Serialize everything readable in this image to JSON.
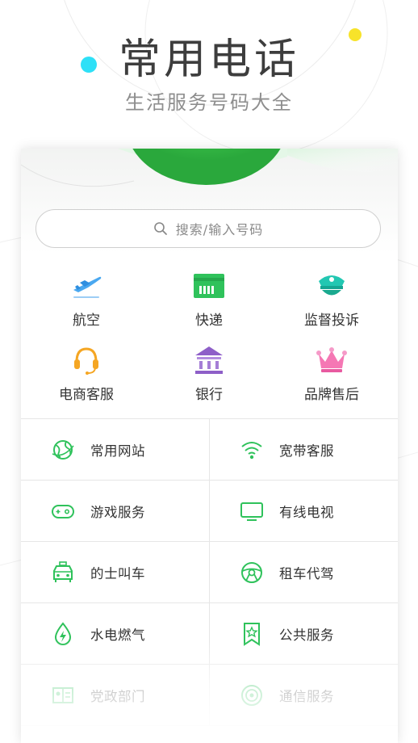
{
  "hero": {
    "title": "常用电话",
    "subtitle": "生活服务号码大全"
  },
  "search": {
    "placeholder": "搜索/输入号码",
    "icon": "search-icon"
  },
  "colors": {
    "accent_green": "#2fc25b",
    "cyan_dot": "#2ee0f7",
    "yellow_dot": "#f7e32a"
  },
  "categories": [
    {
      "label": "航空",
      "icon": "airplane-icon"
    },
    {
      "label": "快递",
      "icon": "express-card-icon"
    },
    {
      "label": "监督投诉",
      "icon": "police-cap-icon"
    },
    {
      "label": "电商客服",
      "icon": "headset-icon"
    },
    {
      "label": "银行",
      "icon": "bank-icon"
    },
    {
      "label": "品牌售后",
      "icon": "crown-icon"
    }
  ],
  "services": [
    {
      "label": "常用网站",
      "icon": "globe-icon"
    },
    {
      "label": "宽带客服",
      "icon": "wifi-icon"
    },
    {
      "label": "游戏服务",
      "icon": "gamepad-icon"
    },
    {
      "label": "有线电视",
      "icon": "tv-icon"
    },
    {
      "label": "的士叫车",
      "icon": "taxi-icon"
    },
    {
      "label": "租车代驾",
      "icon": "steering-wheel-icon"
    },
    {
      "label": "水电燃气",
      "icon": "utilities-drop-icon"
    },
    {
      "label": "公共服务",
      "icon": "bookmark-star-icon"
    },
    {
      "label": "党政部门",
      "icon": "government-icon"
    },
    {
      "label": "通信服务",
      "icon": "signal-icon"
    }
  ]
}
